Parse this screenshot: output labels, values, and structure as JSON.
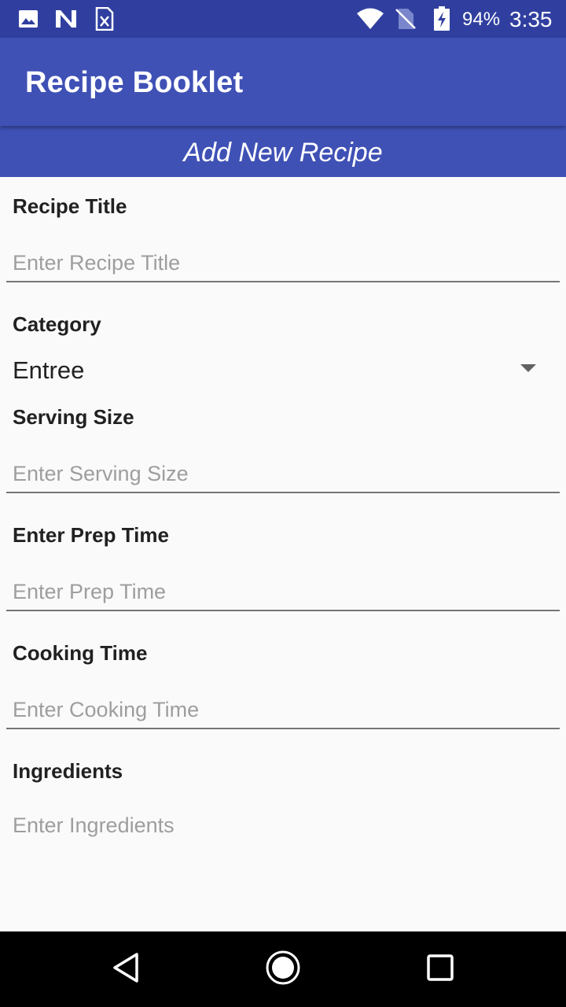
{
  "status_bar": {
    "battery": "94%",
    "time": "3:35",
    "left_icons": [
      "image-icon",
      "n-app-icon",
      "sheet-icon"
    ],
    "right_icons": [
      "wifi-icon",
      "no-sim-icon",
      "battery-charging-icon"
    ]
  },
  "app_bar": {
    "title": "Recipe Booklet"
  },
  "sub_header": {
    "title": "Add New Recipe"
  },
  "form": {
    "recipe_title": {
      "label": "Recipe Title",
      "placeholder": "Enter Recipe Title",
      "value": ""
    },
    "category": {
      "label": "Category",
      "selected": "Entree"
    },
    "serving_size": {
      "label": "Serving Size",
      "placeholder": "Enter Serving Size",
      "value": ""
    },
    "prep_time": {
      "label": "Enter Prep Time",
      "placeholder": "Enter Prep Time",
      "value": ""
    },
    "cooking_time": {
      "label": "Cooking Time",
      "placeholder": "Enter Cooking Time",
      "value": ""
    },
    "ingredients": {
      "label": "Ingredients",
      "placeholder": "Enter Ingredients",
      "value": ""
    }
  },
  "nav_bar": {
    "icons": [
      "back-icon",
      "home-icon",
      "recents-icon"
    ]
  },
  "colors": {
    "primary": "#3f51b5",
    "primary_dark": "#303f9f",
    "background": "#fafafa"
  }
}
